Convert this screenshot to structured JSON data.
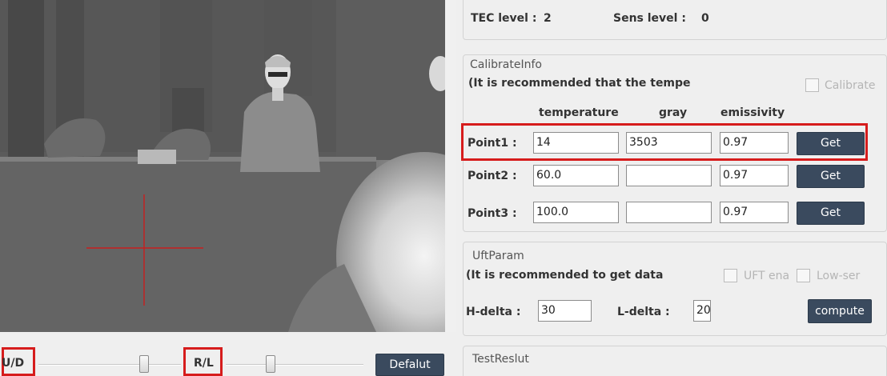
{
  "controls": {
    "ud_label": "U/D",
    "rl_label": "R/L",
    "default_button": "Defalut"
  },
  "levels": {
    "tec_label": "TEC level :",
    "tec_value": "2",
    "sens_label": "Sens level :",
    "sens_value": "0"
  },
  "calibrate": {
    "title": "CalibrateInfo",
    "note": "(It is recommended that the tempe",
    "checkbox_label": "Calibrate",
    "headers": [
      "temperature",
      "gray",
      "emissivity"
    ],
    "points": [
      {
        "label": "Point1 :",
        "temperature": "14",
        "gray": "3503",
        "emissivity": "0.97",
        "button": "Get"
      },
      {
        "label": "Point2 :",
        "temperature": "60.0",
        "gray": "",
        "emissivity": "0.97",
        "button": "Get"
      },
      {
        "label": "Point3 :",
        "temperature": "100.0",
        "gray": "",
        "emissivity": "0.97",
        "button": "Get"
      }
    ]
  },
  "uft": {
    "title": "UftParam",
    "note": "(It is recommended to get data",
    "uft_ena_label": "UFT ena",
    "low_sen_label": "Low-ser",
    "h_delta_label": "H-delta :",
    "h_delta_value": "30",
    "l_delta_label": "L-delta :",
    "l_delta_value": "20",
    "compute_button": "compute"
  },
  "test": {
    "title": "TestReslut"
  },
  "colors": {
    "highlight": "#d61c1c",
    "button_bg": "#3a4a5e",
    "crosshair": "#c81e1e"
  }
}
